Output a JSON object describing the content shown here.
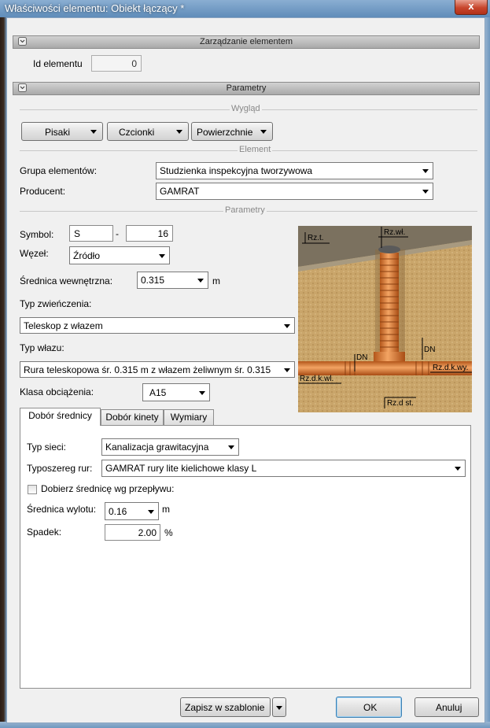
{
  "window": {
    "title": "Właściwości elementu: Obiekt łączący *",
    "close_label": "x"
  },
  "sections": {
    "manage": "Zarządzanie elementem",
    "params": "Parametry"
  },
  "element_id": {
    "label": "Id elementu",
    "value": "0"
  },
  "groups": {
    "appearance": "Wygląd",
    "element": "Element",
    "parameters": "Parametry"
  },
  "appearance_buttons": {
    "pens": "Pisaki",
    "fonts": "Czcionki",
    "surfaces": "Powierzchnie"
  },
  "element": {
    "group_label": "Grupa elementów:",
    "group_value": "Studzienka inspekcyjna tworzywowa",
    "producer_label": "Producent:",
    "producer_value": "GAMRAT"
  },
  "params": {
    "symbol_label": "Symbol:",
    "symbol_prefix": "S",
    "symbol_dash": "-",
    "symbol_number": "16",
    "node_label": "Węzeł:",
    "node_value": "Źródło",
    "inner_diameter_label": "Średnica wewnętrzna:",
    "inner_diameter_value": "0.315",
    "inner_diameter_unit": "m",
    "closure_type_label": "Typ zwieńczenia:",
    "closure_type_value": "Teleskop z włazem",
    "hatch_type_label": "Typ włazu:",
    "hatch_type_value": "Rura teleskopowa śr. 0.315 m z włazem żeliwnym śr. 0.315",
    "load_class_label": "Klasa obciążenia:",
    "load_class_value": "A15"
  },
  "diagram_labels": {
    "rzt": "Rz.t.",
    "rzwl": "Rz.wł.",
    "dn_left": "DN",
    "dn_right": "DN",
    "rzdkwl": "Rz.d.k.wl.",
    "rzdkwy": "Rz.d.k.wy.",
    "rzdst": "Rz.d st."
  },
  "tabs": [
    "Dobór średnicy",
    "Dobór kinety",
    "Wymiary"
  ],
  "diameter_tab": {
    "network_type_label": "Typ sieci:",
    "network_type_value": "Kanalizacja grawitacyjna",
    "pipe_series_label": "Typoszereg rur:",
    "pipe_series_value": "GAMRAT rury lite kielichowe klasy L",
    "flow_checkbox_label": "Dobierz średnicę wg przepływu:",
    "flow_checkbox_checked": false,
    "outlet_diameter_label": "Średnica wylotu:",
    "outlet_diameter_value": "0.16",
    "outlet_diameter_unit": "m",
    "slope_label": "Spadek:",
    "slope_value": "2.00",
    "slope_unit": "%"
  },
  "footer": {
    "save_template": "Zapisz w szablonie",
    "ok": "OK",
    "cancel": "Anuluj"
  }
}
